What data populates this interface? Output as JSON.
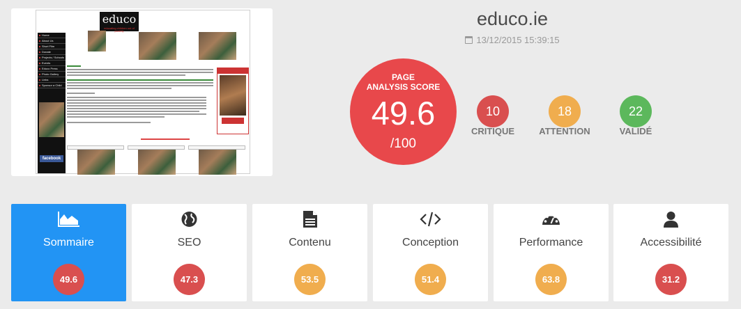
{
  "header": {
    "domain": "educo.ie",
    "date": "13/12/2015 15:39:15"
  },
  "score": {
    "label_line1": "PAGE",
    "label_line2": "ANALYSIS SCORE",
    "value": "49.6",
    "max": "/100",
    "color": "#e8484b"
  },
  "counts": [
    {
      "value": "10",
      "label": "CRITIQUE",
      "color": "#d94f4f"
    },
    {
      "value": "18",
      "label": "ATTENTION",
      "color": "#f0ad4e"
    },
    {
      "value": "22",
      "label": "VALIDÉ",
      "color": "#5cb85c"
    }
  ],
  "categories": [
    {
      "name": "Sommaire",
      "score": "49.6",
      "icon": "area-chart-icon",
      "color": "#d94f4f",
      "active": true
    },
    {
      "name": "SEO",
      "score": "47.3",
      "icon": "globe-icon",
      "color": "#d94f4f"
    },
    {
      "name": "Contenu",
      "score": "53.5",
      "icon": "document-icon",
      "color": "#f0ad4e"
    },
    {
      "name": "Conception",
      "score": "51.4",
      "icon": "code-icon",
      "color": "#f0ad4e"
    },
    {
      "name": "Performance",
      "score": "63.8",
      "icon": "dashboard-icon",
      "color": "#f0ad4e"
    },
    {
      "name": "Accessibilité",
      "score": "31.2",
      "icon": "user-icon",
      "color": "#d94f4f"
    }
  ],
  "thumbnail": {
    "logo": "educo",
    "logo_tagline": "educating children out of poverty",
    "nav": [
      "Home",
      "About Us",
      "Short Film",
      "Donate",
      "Projects / Schools",
      "Events",
      "Educo Press",
      "Photo Gallery",
      "Links",
      "Sponsor a Child"
    ],
    "facebook": "facebook"
  }
}
